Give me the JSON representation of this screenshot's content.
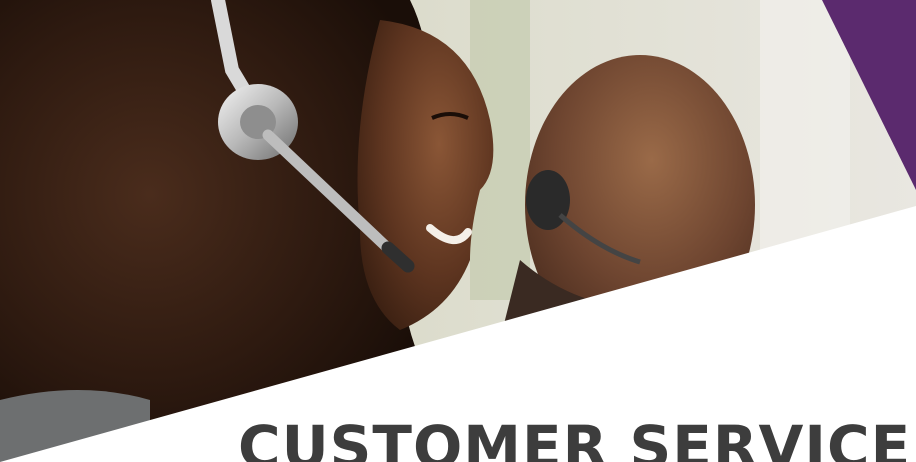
{
  "banner": {
    "headline": "CUSTOMER SERVICE",
    "accent_color": "#5b2a6e",
    "headline_color": "#3d3d3d",
    "photo_description_icon": "customer-service-agents-photo"
  }
}
